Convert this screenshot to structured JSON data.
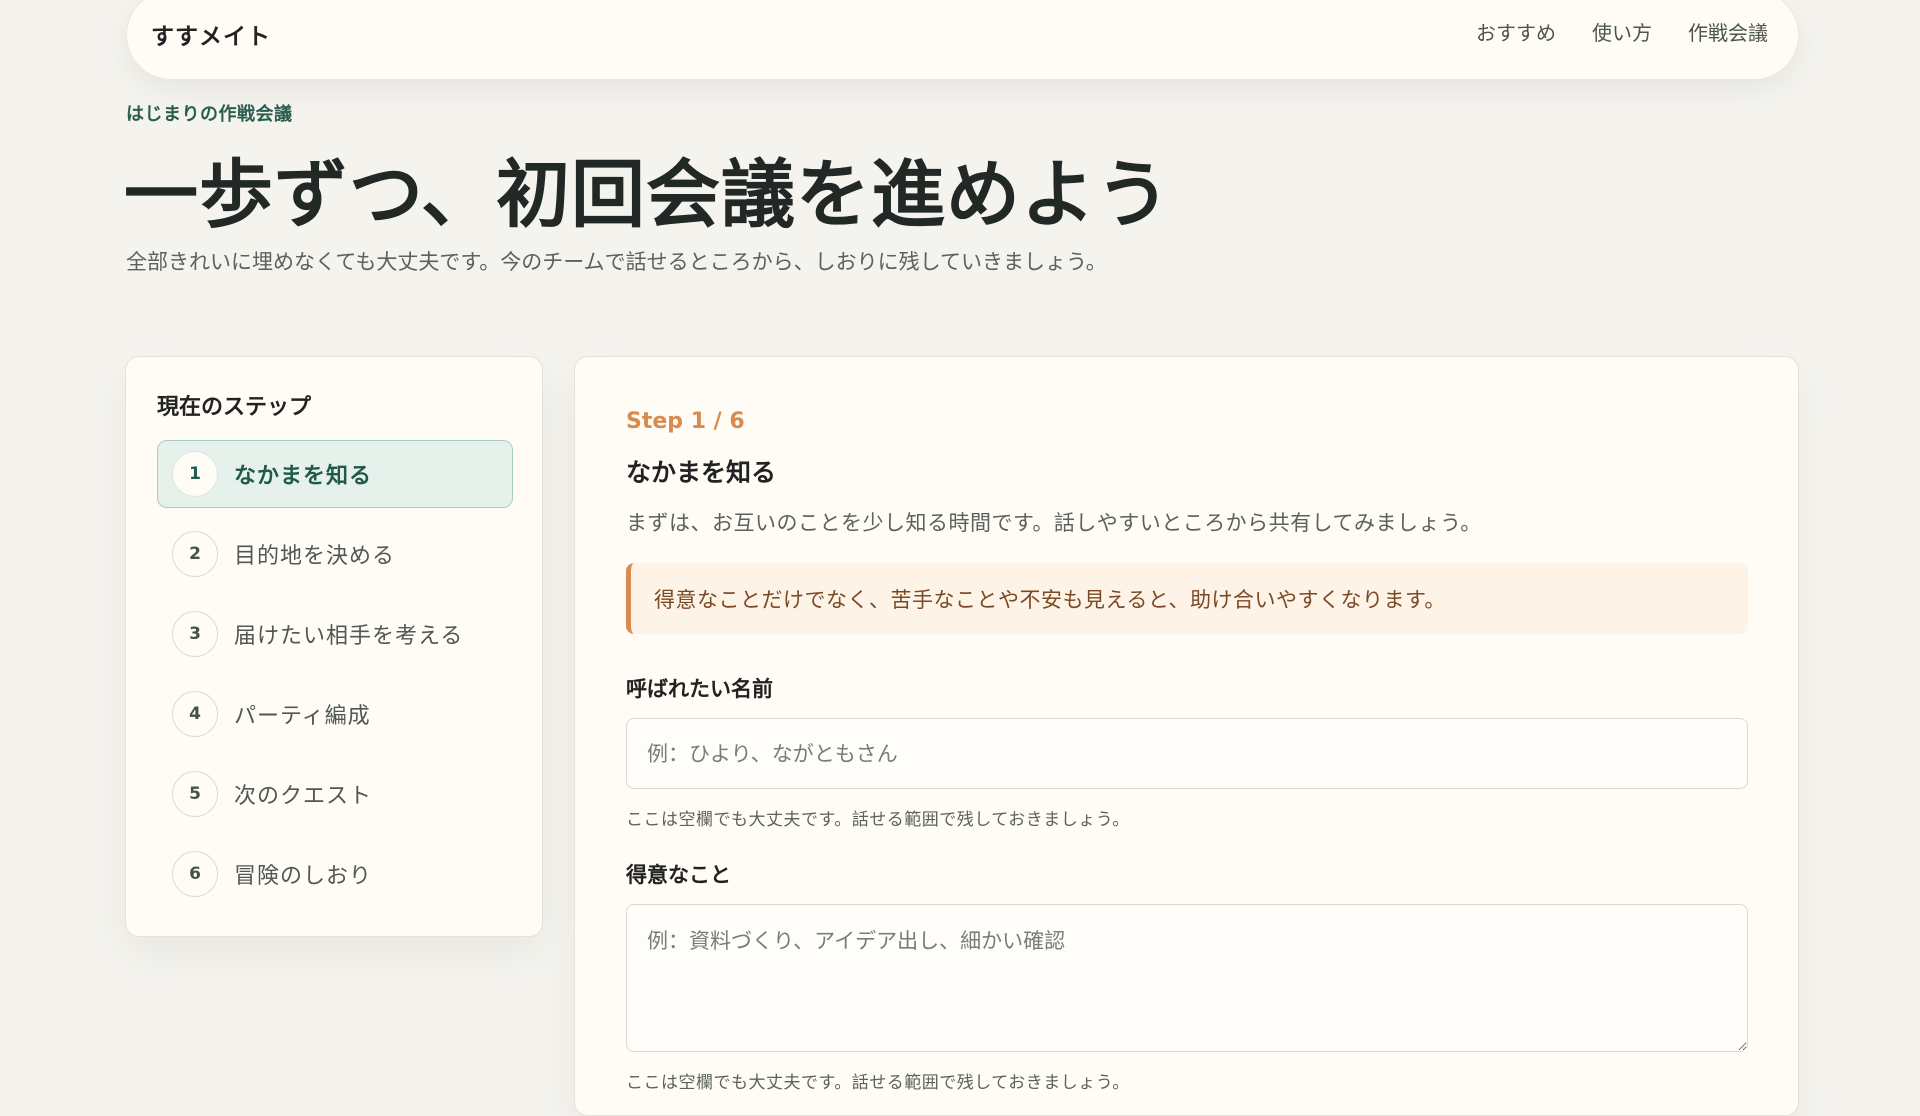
{
  "nav": {
    "brand": "すすメイト",
    "links": [
      "おすすめ",
      "使い方",
      "作戦会議"
    ]
  },
  "hero": {
    "eyebrow": "はじまりの作戦会議",
    "title": "一歩ずつ、初回会議を進めよう",
    "subtitle": "全部きれいに埋めなくても大丈夫です。今のチームで話せるところから、しおりに残していきましょう。"
  },
  "steps": {
    "heading": "現在のステップ",
    "items": [
      {
        "num": "1",
        "label": "なかまを知る"
      },
      {
        "num": "2",
        "label": "目的地を決める"
      },
      {
        "num": "3",
        "label": "届けたい相手を考える"
      },
      {
        "num": "4",
        "label": "パーティ編成"
      },
      {
        "num": "5",
        "label": "次のクエスト"
      },
      {
        "num": "6",
        "label": "冒険のしおり"
      }
    ]
  },
  "main": {
    "counter": "Step 1 / 6",
    "title": "なかまを知る",
    "description": "まずは、お互いのことを少し知る時間です。話しやすいところから共有してみましょう。",
    "tip": "得意なことだけでなく、苦手なことや不安も見えると、助け合いやすくなります。",
    "fields": [
      {
        "label": "呼ばれたい名前",
        "placeholder": "例：ひより、ながともさん",
        "value": "",
        "hint": "ここは空欄でも大丈夫です。話せる範囲で残しておきましょう。"
      },
      {
        "label": "得意なこと",
        "placeholder": "例：資料づくり、アイデア出し、細かい確認",
        "value": "",
        "hint": "ここは空欄でも大丈夫です。話せる範囲で残しておきましょう。"
      }
    ]
  }
}
